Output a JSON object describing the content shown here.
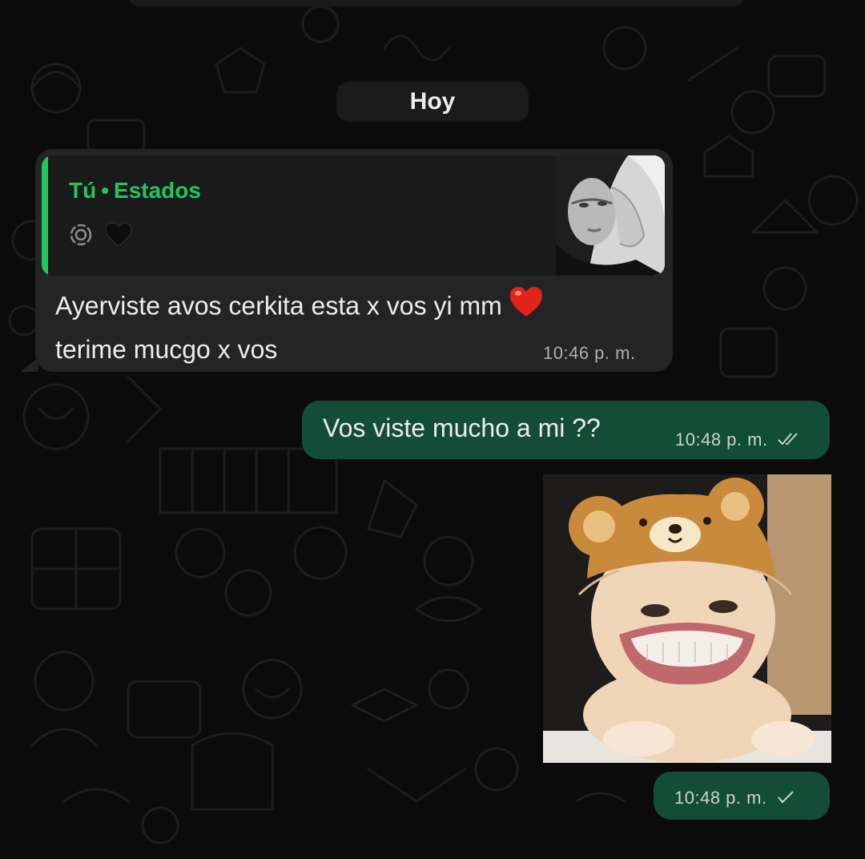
{
  "date_separator": "Hoy",
  "incoming": {
    "quote": {
      "author": "Tú",
      "separator": "•",
      "source": "Estados"
    },
    "text_line1": "Ayerviste avos cerkita esta x vos yi mm",
    "text_line2": "terime mucgo x vos",
    "time": "10:46 p. m."
  },
  "outgoing_text": {
    "text": "Vos viste mucho a mi ??",
    "time": "10:48 p. m.",
    "status": "read"
  },
  "outgoing_sticker": {
    "time": "10:48 p. m.",
    "status": "sent"
  },
  "colors": {
    "background": "#0b0b0b",
    "incoming_bubble": "#242424",
    "outgoing_bubble": "#144d37",
    "accent_green": "#22c55e",
    "heart": "#e2231a"
  }
}
